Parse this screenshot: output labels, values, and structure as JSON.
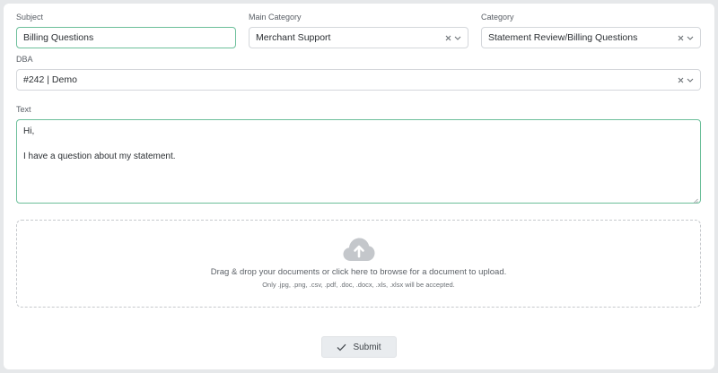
{
  "form": {
    "subject": {
      "label": "Subject",
      "value": "Billing Questions"
    },
    "main_category": {
      "label": "Main Category",
      "value": "Merchant Support"
    },
    "category": {
      "label": "Category",
      "value": "Statement Review/Billing Questions"
    },
    "dba": {
      "label": "DBA",
      "value": "#242 | Demo"
    },
    "text": {
      "label": "Text",
      "lines": [
        "Hi,",
        "",
        "I have a question about my statement."
      ]
    },
    "upload": {
      "main_text": "Drag & drop your documents or click here to browse for a document to upload.",
      "sub_text": "Only .jpg, .png, .csv, .pdf, .doc, .docx, .xls, .xlsx will be accepted."
    },
    "submit_label": "Submit"
  },
  "icons": {
    "clear": "close-icon",
    "dropdown": "chevron-down-icon",
    "upload": "cloud-upload-icon",
    "submit": "check-icon"
  },
  "colors": {
    "focus_border": "#6cbf9a",
    "upload_icon": "#c4c7cb",
    "button_bg": "#e9ecef"
  }
}
